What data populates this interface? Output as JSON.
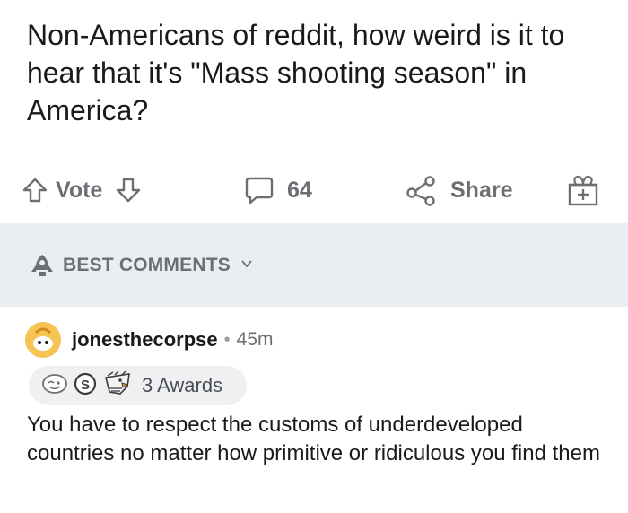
{
  "post": {
    "title": "Non-Americans of reddit, how weird is it to hear that it's \"Mass shooting season\" in America?"
  },
  "actions": {
    "vote_label": "Vote",
    "comment_count": "64",
    "share_label": "Share",
    "icons": [
      "arrow-up-icon",
      "arrow-down-icon",
      "comment-bubble-icon",
      "share-icon",
      "gift-icon"
    ]
  },
  "sort": {
    "label": "BEST COMMENTS",
    "icon": "rocket-icon"
  },
  "comment": {
    "username": "jonesthecorpse",
    "separator": "•",
    "time": "45m",
    "awards_label": "3 Awards",
    "body": "You have to respect the customs of underdeveloped countries no matter how primitive or ridiculous you find them"
  },
  "colors": {
    "text": "#1a1a1b",
    "muted": "#6b6e72",
    "sort_bar_bg": "#e9eef2",
    "award_pill_bg": "#eef0f2"
  }
}
